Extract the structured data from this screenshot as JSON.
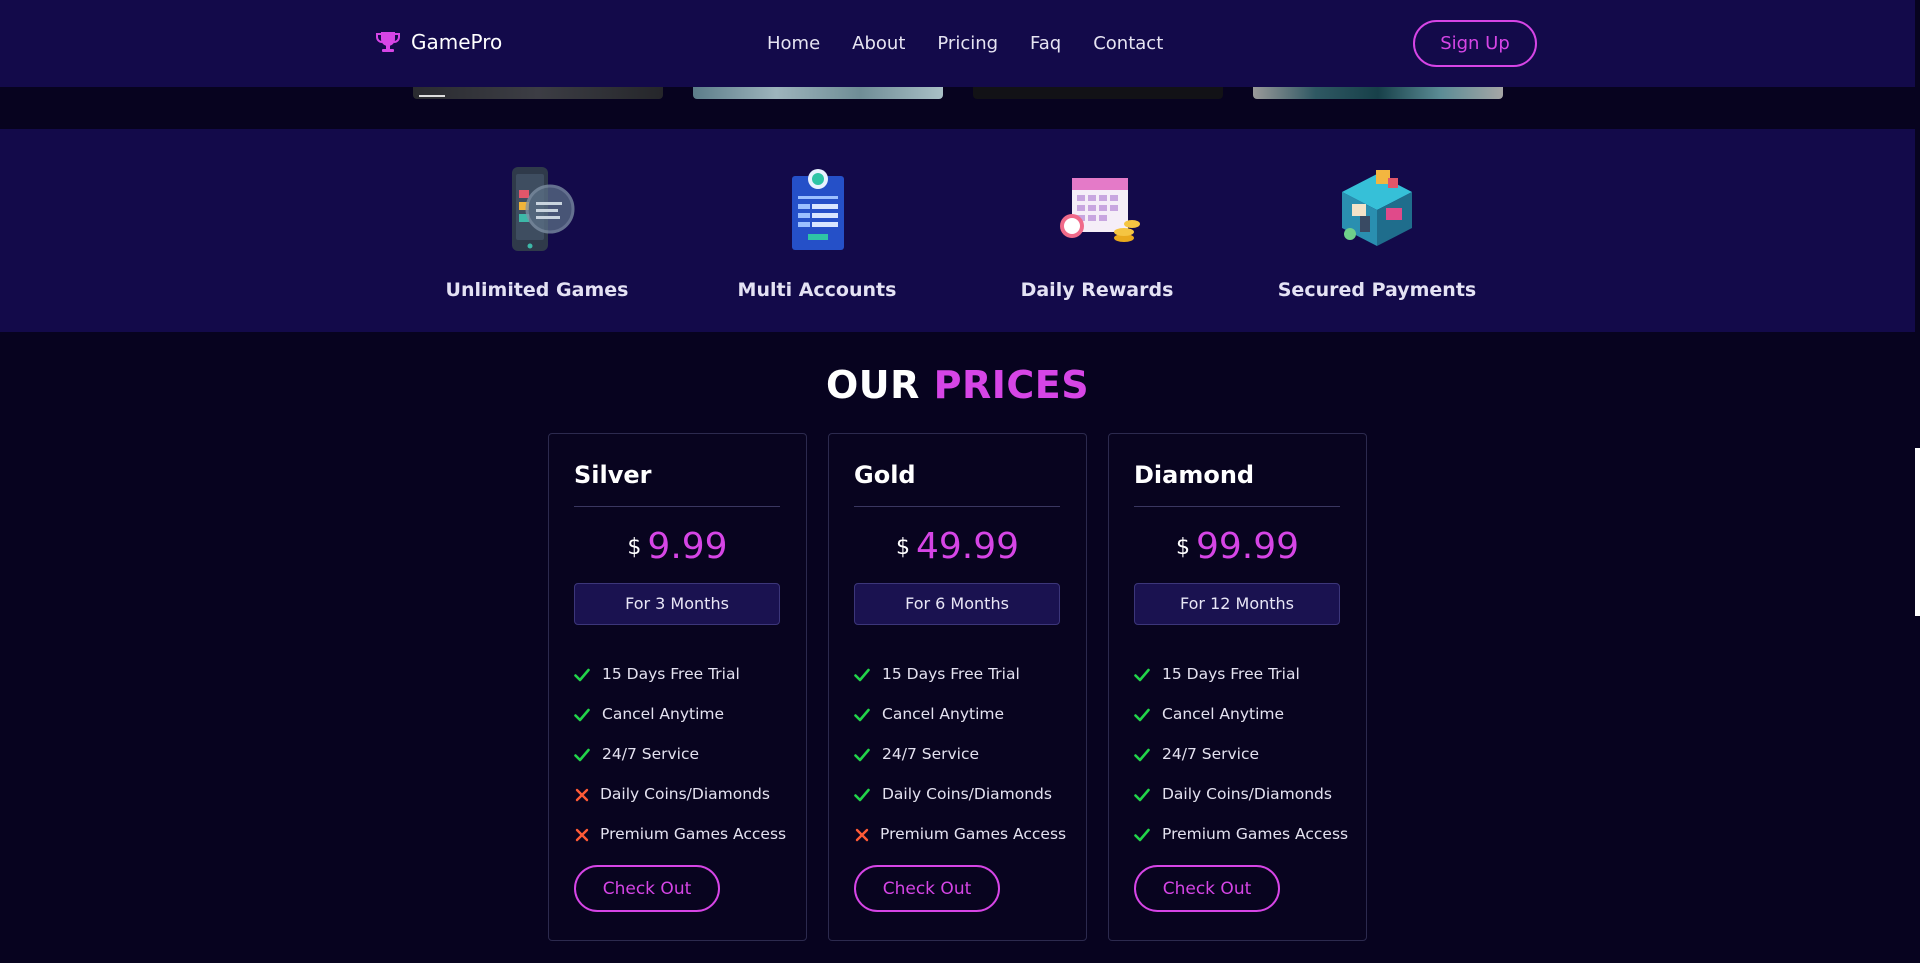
{
  "header": {
    "brand": "GamePro",
    "nav": [
      "Home",
      "About",
      "Pricing",
      "Faq",
      "Contact"
    ],
    "signup_label": "Sign Up"
  },
  "features": [
    {
      "title": "Unlimited Games",
      "icon": "phone-magnifier-icon"
    },
    {
      "title": "Multi Accounts",
      "icon": "id-clipboard-icon"
    },
    {
      "title": "Daily Rewards",
      "icon": "calendar-coins-icon"
    },
    {
      "title": "Secured Payments",
      "icon": "isometric-shop-icon"
    }
  ],
  "prices_section": {
    "title_main": "OUR",
    "title_accent": "PRICES"
  },
  "plans": [
    {
      "name": "Silver",
      "currency": "$",
      "amount": "9.99",
      "period": "For 3 Months",
      "features": [
        {
          "text": "15 Days Free Trial",
          "included": true
        },
        {
          "text": "Cancel Anytime",
          "included": true
        },
        {
          "text": "24/7 Service",
          "included": true
        },
        {
          "text": "Daily Coins/Diamonds",
          "included": false
        },
        {
          "text": "Premium Games Access",
          "included": false
        }
      ],
      "cta": "Check Out"
    },
    {
      "name": "Gold",
      "currency": "$",
      "amount": "49.99",
      "period": "For 6 Months",
      "features": [
        {
          "text": "15 Days Free Trial",
          "included": true
        },
        {
          "text": "Cancel Anytime",
          "included": true
        },
        {
          "text": "24/7 Service",
          "included": true
        },
        {
          "text": "Daily Coins/Diamonds",
          "included": true
        },
        {
          "text": "Premium Games Access",
          "included": false
        }
      ],
      "cta": "Check Out"
    },
    {
      "name": "Diamond",
      "currency": "$",
      "amount": "99.99",
      "period": "For 12 Months",
      "features": [
        {
          "text": "15 Days Free Trial",
          "included": true
        },
        {
          "text": "Cancel Anytime",
          "included": true
        },
        {
          "text": "24/7 Service",
          "included": true
        },
        {
          "text": "Daily Coins/Diamonds",
          "included": true
        },
        {
          "text": "Premium Games Access",
          "included": true
        }
      ],
      "cta": "Check Out"
    }
  ],
  "colors": {
    "background": "#07031f",
    "band": "#130a4a",
    "accent": "#d645e6",
    "check": "#22d44a",
    "cross": "#ff5a36"
  }
}
